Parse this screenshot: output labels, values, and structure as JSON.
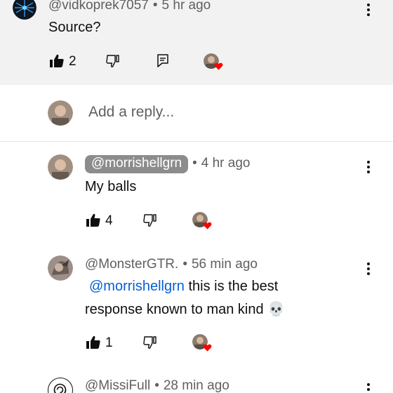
{
  "comment_top": {
    "handle": "@vidkoprek7057",
    "separator": "•",
    "time": "5 hr ago",
    "text": "Source?",
    "likes": "2"
  },
  "reply_box": {
    "placeholder": "Add a reply..."
  },
  "reply_1": {
    "handle": "@morrishellgrn",
    "separator": "•",
    "time": "4 hr ago",
    "text": "My balls",
    "likes": "4"
  },
  "reply_2": {
    "handle": "@MonsterGTR.",
    "separator": "•",
    "time": "56 min ago",
    "mention": "@morrishellgrn",
    "text_line1": " this is the best",
    "text_line2": "response known to man kind",
    "emoji": "💀",
    "likes": "1"
  },
  "reply_3": {
    "handle": "@MissiFull",
    "separator": "•",
    "time": "28 min ago"
  },
  "colors": {
    "highlight_bg": "#f2f2f2",
    "handle_pill_bg": "#8c8c8c",
    "mention": "#065fd4",
    "heart": "#ff0000"
  },
  "icons": [
    "thumbs-up-icon",
    "thumbs-down-icon",
    "reply-icon",
    "more-vert-icon",
    "creator-heart-icon"
  ]
}
